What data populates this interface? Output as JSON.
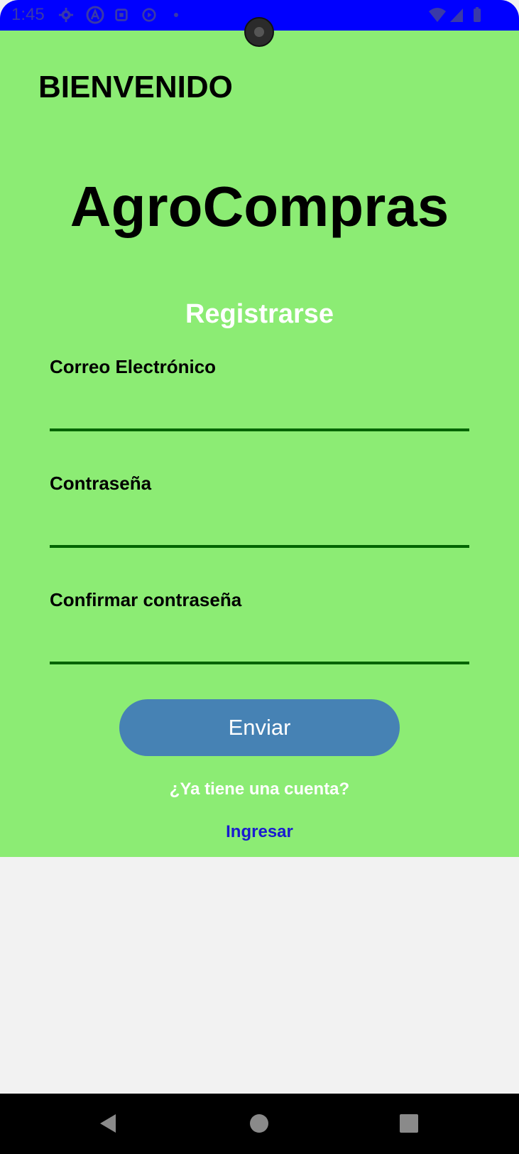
{
  "status_bar": {
    "time": "1:45",
    "icons": [
      "settings-gear-icon",
      "a-circle-icon",
      "calendar-box-icon",
      "record-circle-icon",
      "dot-icon",
      "wifi-icon",
      "signal-icon",
      "battery-icon"
    ]
  },
  "header": {
    "welcome": "BIENVENIDO"
  },
  "brand": {
    "name": "AgroCompras"
  },
  "form": {
    "title": "Registrarse",
    "email_label": "Correo Electrónico",
    "email_value": "",
    "password_label": "Contraseña",
    "password_value": "",
    "confirm_label": "Confirmar contraseña",
    "confirm_value": "",
    "submit_label": "Enviar"
  },
  "footer": {
    "have_account": "¿Ya tiene una cuenta?",
    "login_link": "Ingresar"
  },
  "nav_bar": {
    "icons": [
      "back-icon",
      "home-icon",
      "recents-icon"
    ]
  },
  "colors": {
    "status_bar": "#0000ff",
    "app_background": "#8cec74",
    "input_underline": "#006400",
    "button": "#4682b4",
    "link": "#1a1ad0",
    "page_background": "#f2f2f2"
  }
}
